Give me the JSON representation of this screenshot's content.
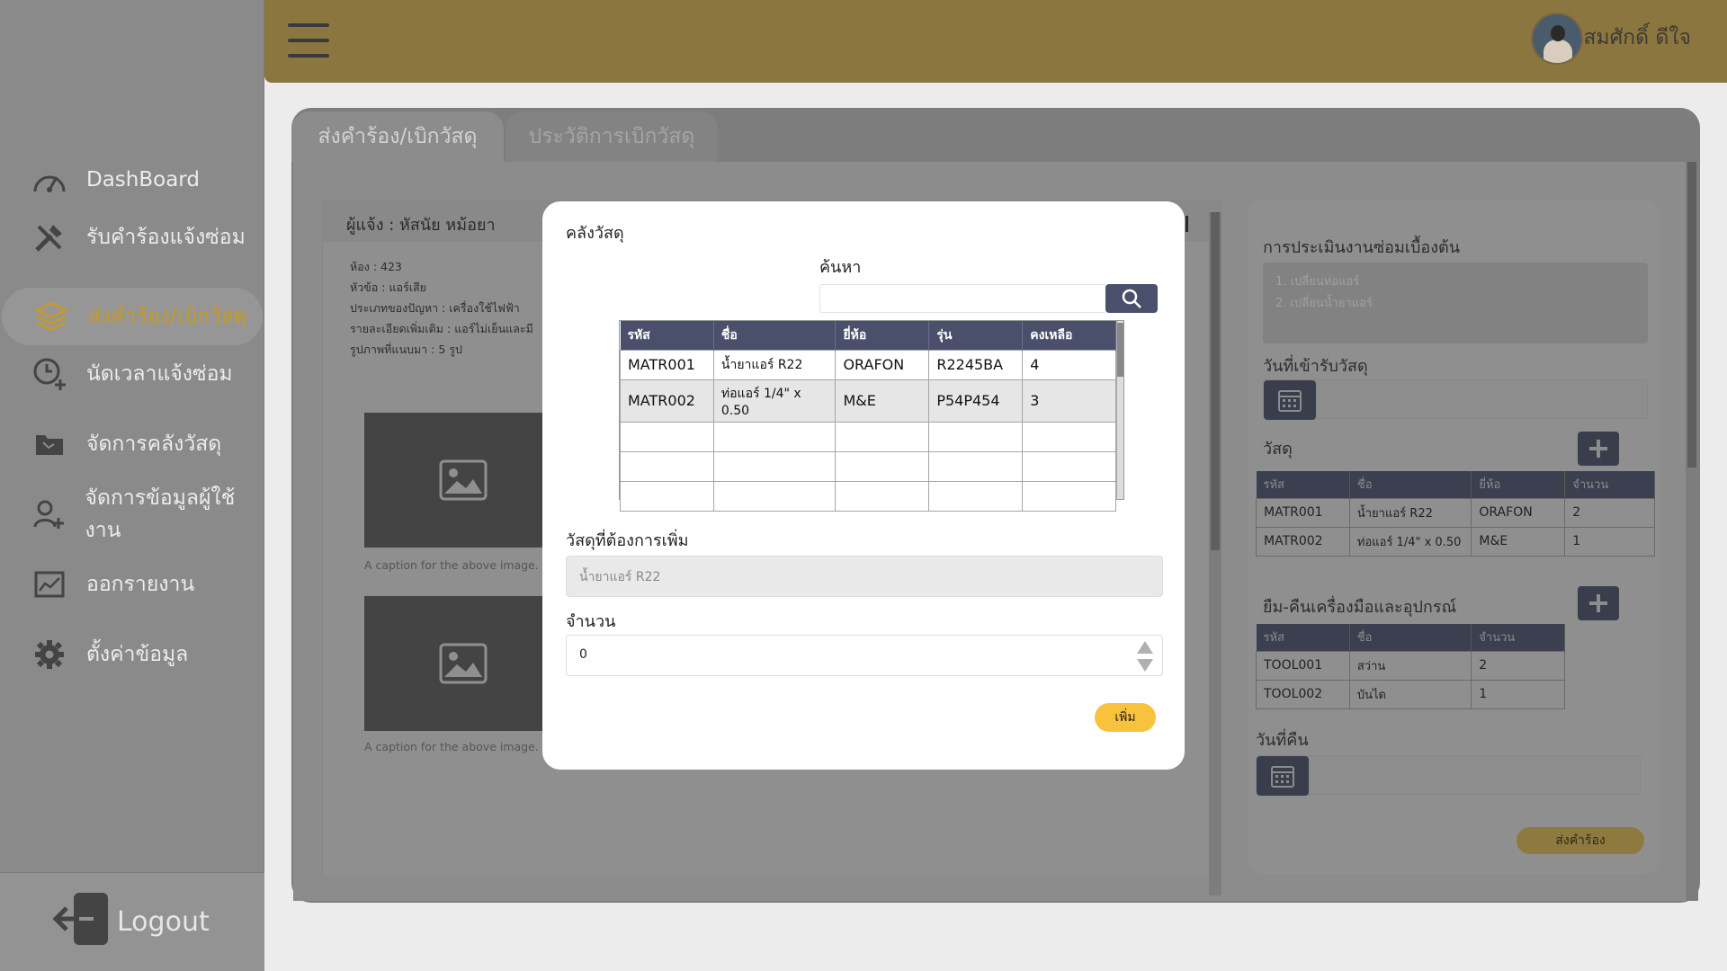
{
  "sidebar": {
    "items": [
      {
        "label": "DashBoard",
        "icon": "dashboard-icon"
      },
      {
        "label": "รับคำร้องแจ้งซ่อม",
        "icon": "tools-icon"
      },
      {
        "label": "ส่งคำร้อง/เบิกวัสดุ",
        "icon": "layers-icon"
      },
      {
        "label": "นัดเวลาแจ้งซ่อม",
        "icon": "clock-plus-icon"
      },
      {
        "label": "จัดการคลังวัสดุ",
        "icon": "folder-icon"
      },
      {
        "label": "จัดการข้อมูลผู้ใช้งาน",
        "icon": "user-plus-icon"
      },
      {
        "label": "ออกรายงาน",
        "icon": "report-icon"
      },
      {
        "label": "ตั้งค่าข้อมูล",
        "icon": "gear-icon"
      }
    ],
    "active_index": 2,
    "logout_label": "Logout"
  },
  "header": {
    "username": "สมศักดิ์ ดีใจ"
  },
  "tabs": [
    {
      "label": "ส่งคำร้อง/เบิกวัสดุ"
    },
    {
      "label": "ประวัติการเบิกวัสดุ"
    }
  ],
  "request": {
    "reporter": "ผู้แจ้ง : หัสนัย หม้อยา",
    "room": "ห้อง : 423",
    "subject": "หัวข้อ : แอร์เสีย",
    "problem_type": "ประเภทของปัญหา : เครื่องใช้ไฟฟ้า",
    "details": "รายละเอียดเพิ่มเติม : แอร์ไม่เย็นและมี",
    "images": "รูปภาพที่แนบมา : 5 รูป",
    "captions": [
      "A caption for the above image.",
      "A caption for the above image."
    ]
  },
  "right_panel": {
    "assess_label": "การประเมินงานซ่อมเบื้องต้น",
    "assess_items": [
      "1. เปลี่ยนท่อแอร์",
      "2. เปลี่ยนน้ำยาแอร์"
    ],
    "receive_date_label": "วันที่เข้ารับวัสดุ",
    "materials_label": "วัสดุ",
    "materials_headers": [
      "รหัส",
      "ชื่อ",
      "ยี่ห้อ",
      "จำนวน"
    ],
    "materials_rows": [
      [
        "MATR001",
        "น้ำยาแอร์ R22",
        "ORAFON",
        "2"
      ],
      [
        "MATR002",
        "ท่อแอร์ 1/4\" x 0.50",
        "M&E",
        "1"
      ]
    ],
    "tools_label": "ยืม-คืนเครื่องมือและอุปกรณ์",
    "tools_headers": [
      "รหัส",
      "ชื่อ",
      "จำนวน"
    ],
    "tools_rows": [
      [
        "TOOL001",
        "สว่าน",
        "2"
      ],
      [
        "TOOL002",
        "บันได",
        "1"
      ]
    ],
    "return_date_label": "วันที่คืน",
    "submit_label": "ส่งคำร้อง"
  },
  "modal": {
    "title": "คลังวัสดุ",
    "search_label": "ค้นหา",
    "search_value": "",
    "table_headers": [
      "รหัส",
      "ชื่อ",
      "ยี่ห้อ",
      "รุ่น",
      "คงเหลือ"
    ],
    "table_rows": [
      [
        "MATR001",
        "น้ำยาแอร์ R22",
        "ORAFON",
        "R2245BA",
        "4"
      ],
      [
        "MATR002",
        "ท่อแอร์ 1/4\" x 0.50",
        "M&E",
        "P54P454",
        "3"
      ],
      [
        "",
        "",
        "",
        "",
        ""
      ],
      [
        "",
        "",
        "",
        "",
        ""
      ],
      [
        "",
        "",
        "",
        "",
        ""
      ]
    ],
    "selected_row": 1,
    "add_label": "วัสดุที่ต้องการเพิ่ม",
    "add_value": "น้ำยาแอร์ R22",
    "qty_label": "จำนวน",
    "qty_value": "0",
    "add_button": "เพิ่ม"
  },
  "colors": {
    "accent_yellow": "#f9c23c",
    "table_header": "#4a4f6c",
    "active_menu": "#c79a22"
  }
}
